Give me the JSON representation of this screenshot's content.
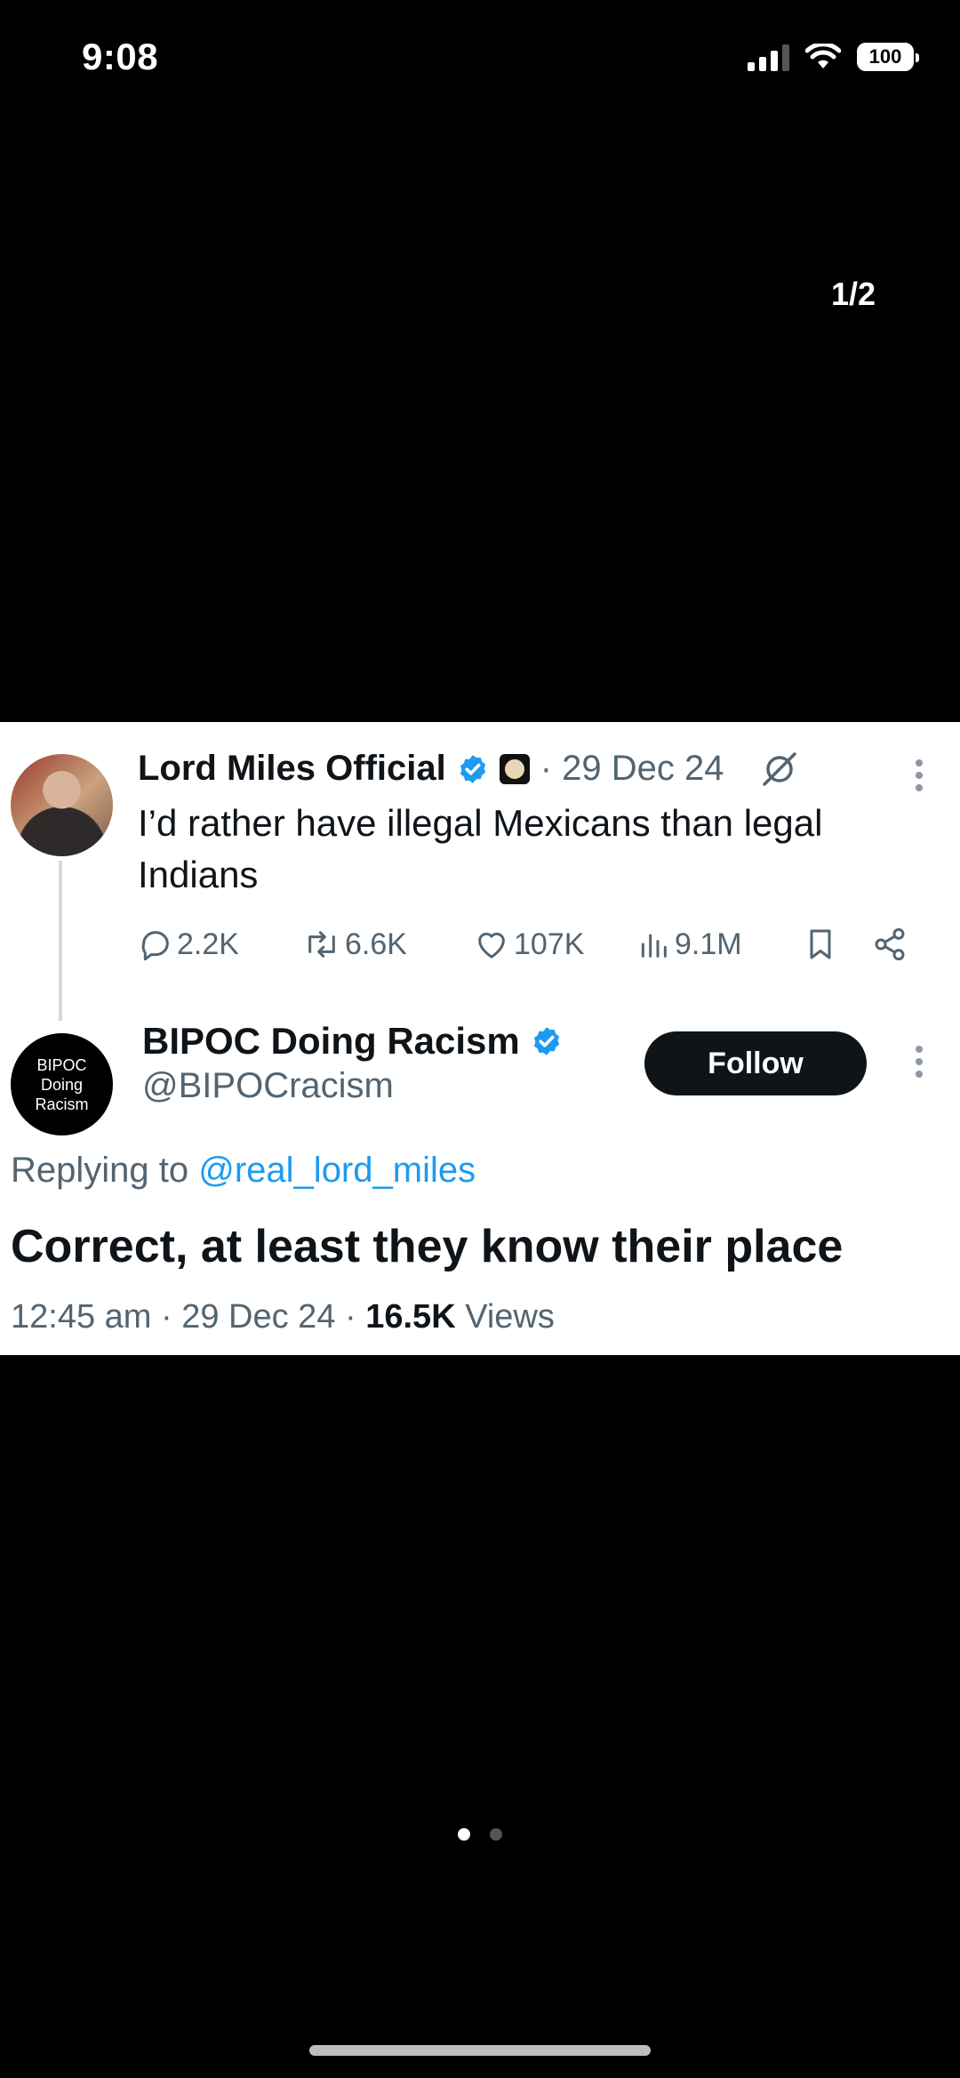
{
  "status_bar": {
    "time": "9:08",
    "battery": "100"
  },
  "viewer": {
    "page_counter": "1/2",
    "pages_total": 2,
    "current_page": 1
  },
  "original_tweet": {
    "display_name": "Lord Miles Official",
    "date": "· 29 Dec 24",
    "text": "I’d rather have illegal Mexicans than legal Indians",
    "metrics": {
      "replies": "2.2K",
      "reposts": "6.6K",
      "likes": "107K",
      "views": "9.1M"
    }
  },
  "reply_tweet": {
    "avatar_text": [
      "BIPOC",
      "Doing",
      "Racism"
    ],
    "display_name": "BIPOC Doing Racism",
    "handle": "@BIPOCracism",
    "follow_label": "Follow",
    "replying_prefix": "Replying to",
    "replying_mention": "@real_lord_miles",
    "text": "Correct, at least they know their place",
    "time": "12:45 am",
    "date": "· 29 Dec 24 ·",
    "views_count": "16.5K",
    "views_label": "Views"
  },
  "colors": {
    "background": "#000000",
    "card": "#ffffff",
    "accent": "#1d9bf0",
    "muted": "#536471"
  },
  "icons": [
    "signal-icon",
    "wifi-icon",
    "battery-icon",
    "verified-badge-icon",
    "affiliate-badge-icon",
    "grok-icon",
    "more-icon",
    "reply-icon",
    "repost-icon",
    "like-icon",
    "views-icon",
    "bookmark-icon",
    "share-icon"
  ]
}
